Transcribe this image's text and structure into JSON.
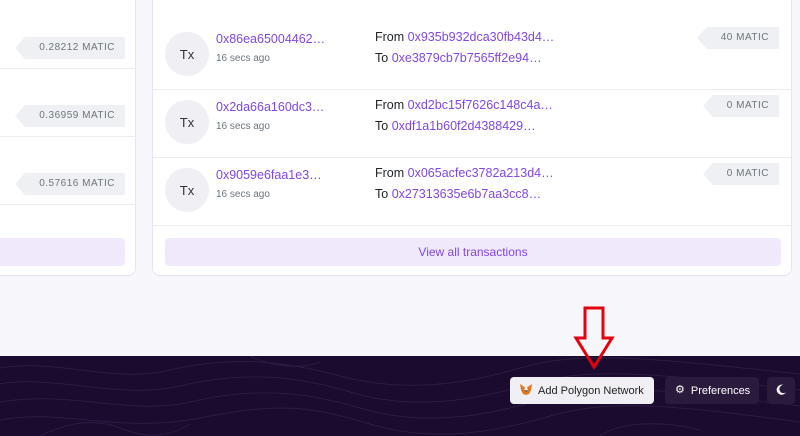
{
  "blocks": {
    "rows": [
      {
        "value": "0.28212 MATIC"
      },
      {
        "value": "0.36959 MATIC"
      },
      {
        "value": "0.57616 MATIC"
      }
    ]
  },
  "transactions": {
    "rows": [
      {
        "avatar": "Tx",
        "hash": "0x86ea65004462…",
        "time": "16 secs ago",
        "from_label": "From",
        "from": "0x935b932dca30fb43d4…",
        "to_label": "To",
        "to": "0xe3879cb7b7565ff2e94…",
        "value": "40 MATIC"
      },
      {
        "avatar": "Tx",
        "hash": "0x2da66a160dc3…",
        "time": "16 secs ago",
        "from_label": "From",
        "from": "0xd2bc15f7626c148c4a…",
        "to_label": "To",
        "to": "0xdf1a1b60f2d4388429…",
        "value": "0 MATIC"
      },
      {
        "avatar": "Tx",
        "hash": "0x9059e6faa1e3…",
        "time": "16 secs ago",
        "from_label": "From",
        "from": "0x065acfec3782a213d4…",
        "to_label": "To",
        "to": "0x27313635e6b7aa3cc8…",
        "value": "0 MATIC"
      }
    ],
    "view_all_label": "View all transactions"
  },
  "footer": {
    "add_network_label": "Add Polygon Network",
    "preferences_label": "Preferences"
  },
  "colors": {
    "accent": "#8247e5",
    "footer_bg": "#1b0b2e",
    "annotation_arrow": "#e3000f"
  },
  "icons": {
    "add_network": "metamask-fox-icon",
    "preferences": "gears-icon",
    "theme": "moon-icon"
  }
}
